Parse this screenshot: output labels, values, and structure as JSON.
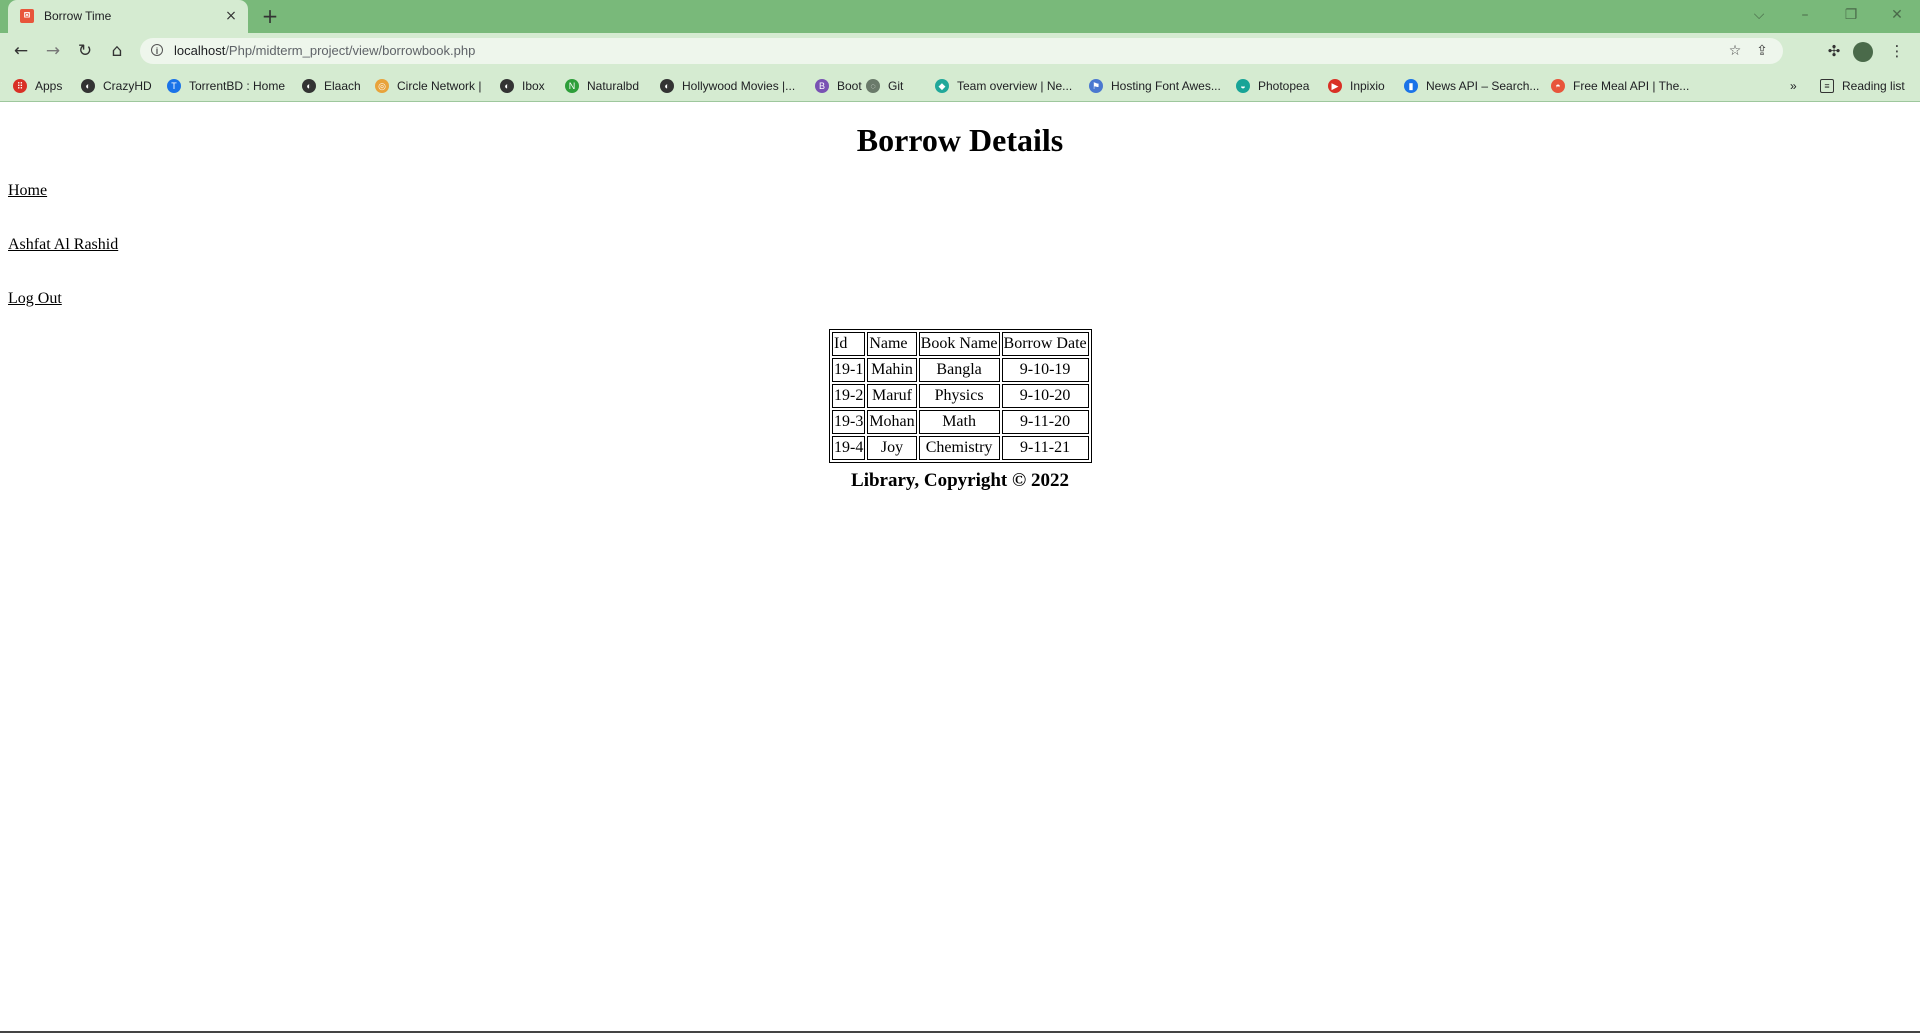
{
  "browser": {
    "tab_title": "Borrow Time",
    "tab_close": "×",
    "new_tab": "+",
    "url_host": "localhost",
    "url_path": "/Php/midterm_project/view/borrowbook.php",
    "bookmarks": [
      {
        "label": "Apps",
        "icon": "apps-grid-icon",
        "color": "#d93025"
      },
      {
        "label": "CrazyHD",
        "icon": "globe-icon",
        "color": "#333333"
      },
      {
        "label": "TorrentBD : Home",
        "icon": "torrentbd-icon",
        "color": "#1a73e8"
      },
      {
        "label": "Elaach",
        "icon": "globe-icon",
        "color": "#333333"
      },
      {
        "label": "Circle Network |",
        "icon": "circle-network-icon",
        "color": "#e8a33b"
      },
      {
        "label": "Ibox",
        "icon": "globe-icon",
        "color": "#333333"
      },
      {
        "label": "Naturalbd",
        "icon": "naturalbd-icon",
        "color": "#2e9e3a"
      },
      {
        "label": "Hollywood Movies |...",
        "icon": "globe-icon",
        "color": "#333333"
      },
      {
        "label": "Boot",
        "icon": "bootstrap-icon",
        "color": "#7952b3"
      },
      {
        "label": "Git",
        "icon": "github-icon",
        "color": "#6a7a6a"
      },
      {
        "label": "Team overview | Ne...",
        "icon": "netlify-icon",
        "color": "#20a89a"
      },
      {
        "label": "Hosting Font Awes...",
        "icon": "flag-icon",
        "color": "#4a78d0"
      },
      {
        "label": "Photopea",
        "icon": "photopea-icon",
        "color": "#18a497"
      },
      {
        "label": "Inpixio",
        "icon": "inpixio-icon",
        "color": "#d93025"
      },
      {
        "label": "News API – Search...",
        "icon": "newsapi-icon",
        "color": "#1a73e8"
      },
      {
        "label": "Free Meal API | The...",
        "icon": "mealdb-icon",
        "color": "#e8553b"
      }
    ],
    "bookmarks_overflow": "»",
    "reading_list": "Reading list"
  },
  "page": {
    "heading": "Borrow Details",
    "nav": {
      "home": "Home",
      "user": "Ashfat Al Rashid",
      "logout": "Log Out"
    },
    "table": {
      "headers": [
        "Id",
        "Name",
        "Book Name",
        "Borrow Date"
      ],
      "rows": [
        [
          "19-1",
          "Mahin",
          "Bangla",
          "9-10-19"
        ],
        [
          "19-2",
          "Maruf",
          "Physics",
          "9-10-20"
        ],
        [
          "19-3",
          "Mohan",
          "Math",
          "9-11-20"
        ],
        [
          "19-4",
          "Joy",
          "Chemistry",
          "9-11-21"
        ]
      ]
    },
    "footer": "Library, Copyright © 2022"
  },
  "colors": {
    "tabstrip": "#79b97a",
    "toolbar": "#d5ebd1"
  }
}
